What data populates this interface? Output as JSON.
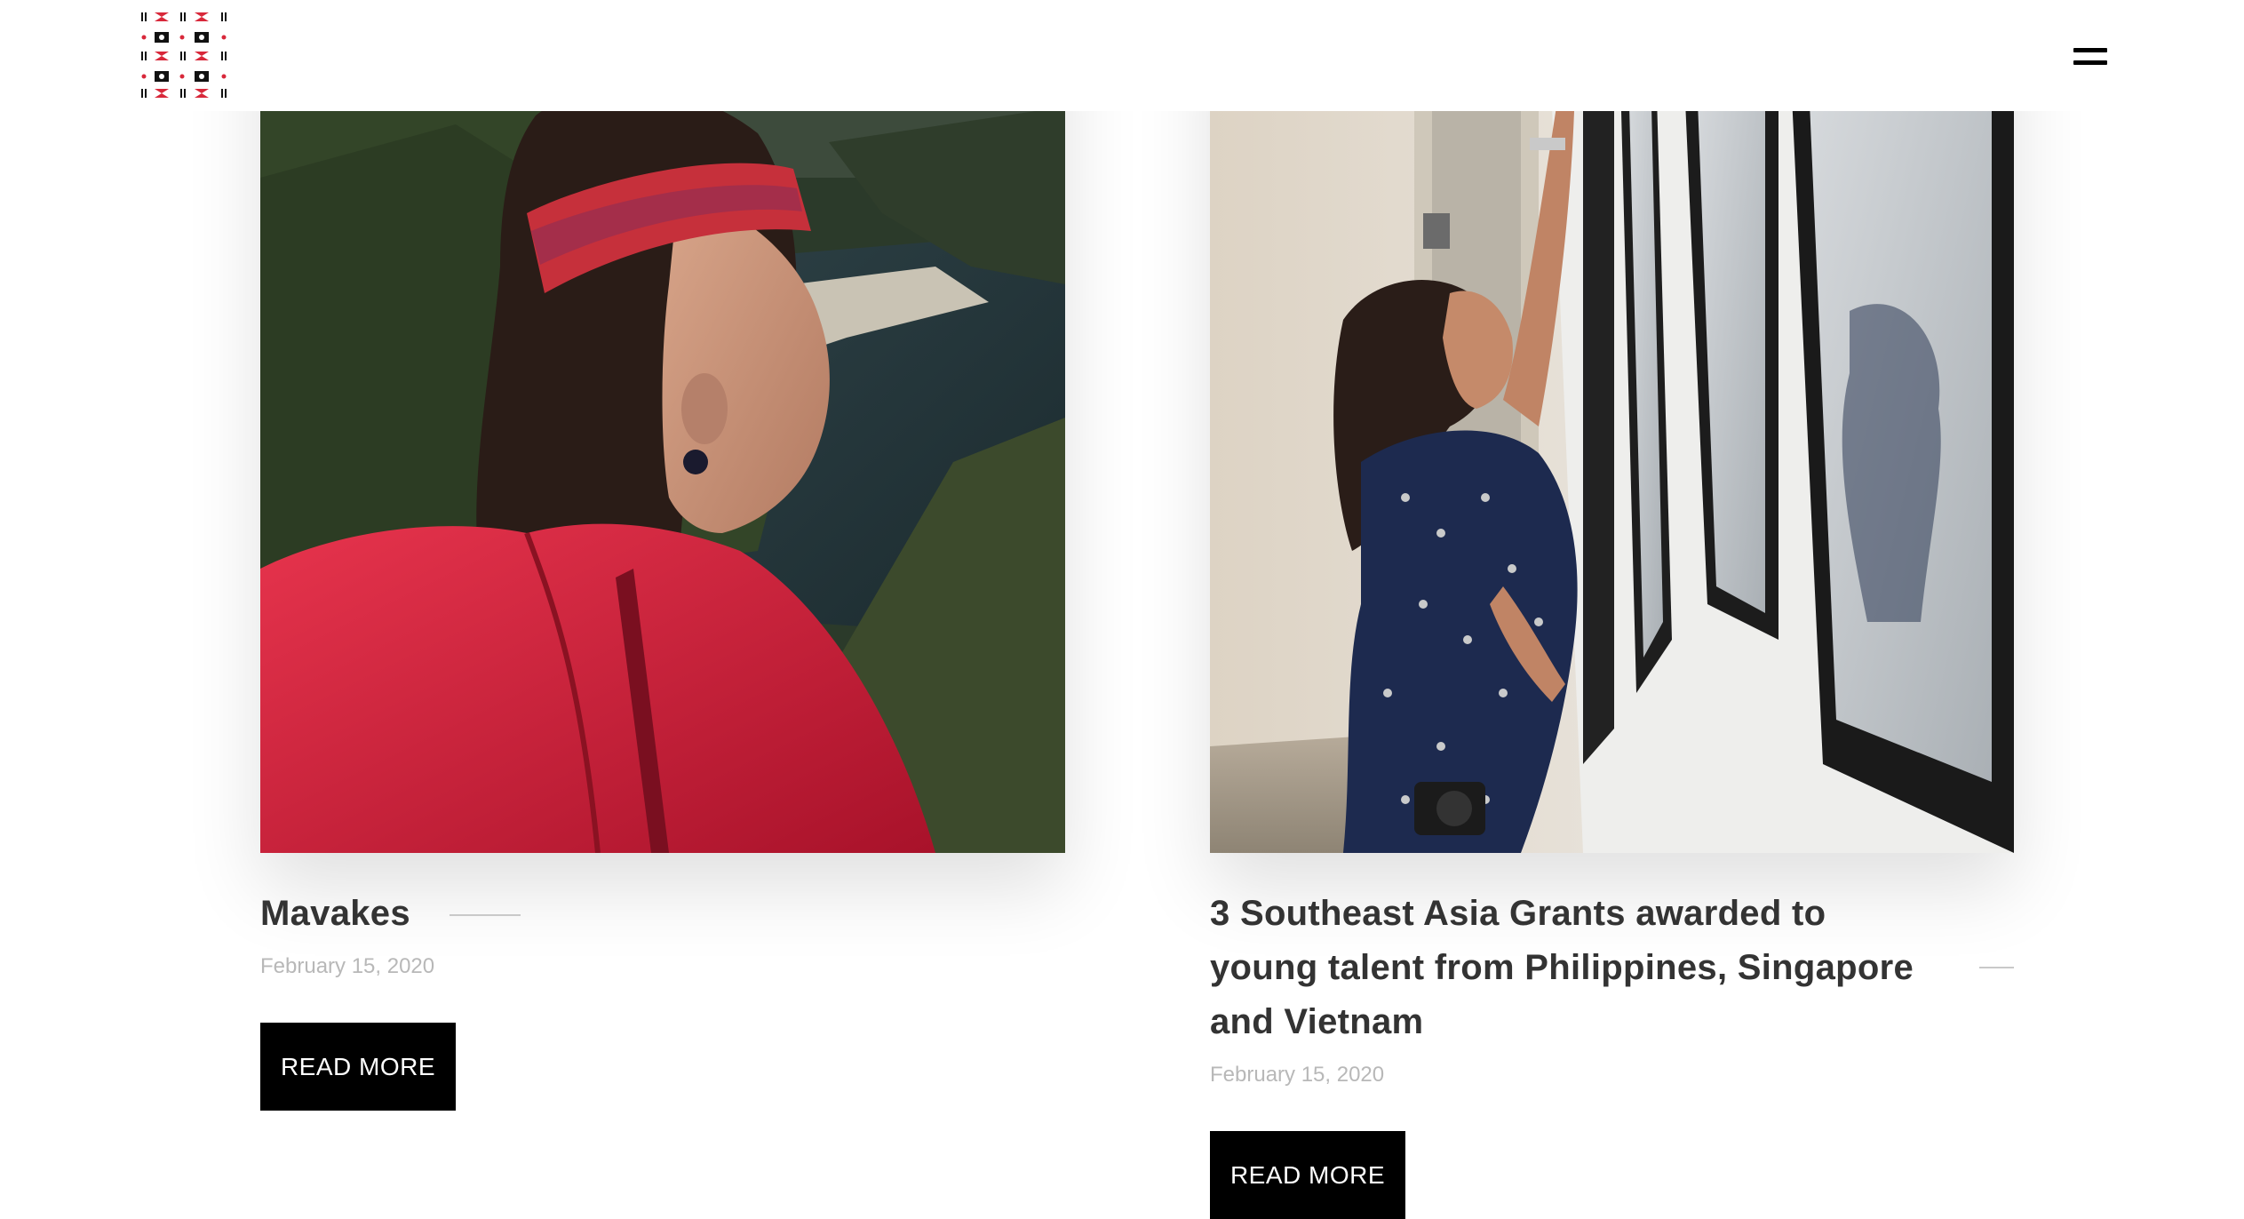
{
  "header": {
    "logo_icon": "woven-pattern-logo-icon",
    "menu_icon": "hamburger-menu-icon"
  },
  "colors": {
    "accent_red": "#d8283a",
    "button_bg": "#000000",
    "button_text": "#ffffff",
    "title_text": "#333333",
    "date_text": "#b8b8b8"
  },
  "posts": [
    {
      "image_subject": "woman in red jacket and woven headband above coastal cliffs",
      "title": "Mavakes",
      "date": "February 15, 2020",
      "button_label": "READ MORE"
    },
    {
      "image_subject": "woman in patterned dress adjusting framed photographs in gallery",
      "title": "3 Southeast Asia Grants awarded to young talent from Philippines, Singapore and Vietnam",
      "date": "February 15, 2020",
      "button_label": "READ MORE"
    }
  ]
}
